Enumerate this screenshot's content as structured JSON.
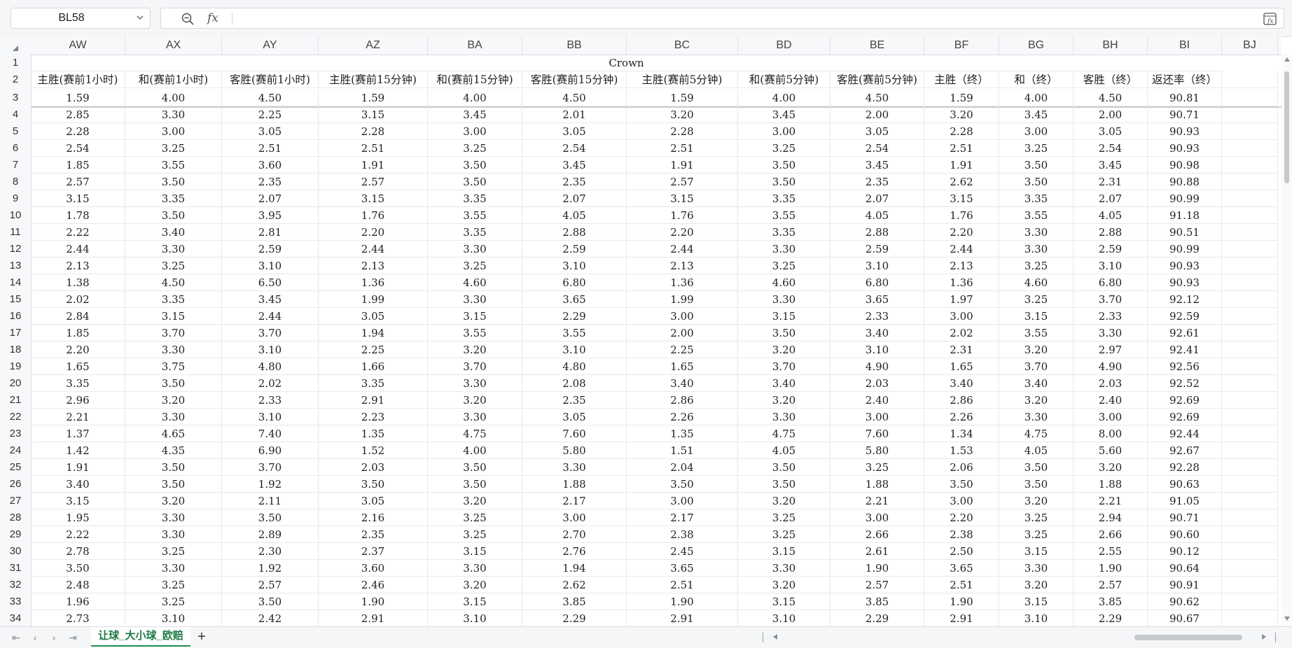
{
  "formula_bar": {
    "name_box": "BL58",
    "fx_label": "fx",
    "formula": ""
  },
  "columns": [
    "AW",
    "AX",
    "AY",
    "AZ",
    "BA",
    "BB",
    "BC",
    "BD",
    "BE",
    "BF",
    "BG",
    "BH",
    "BI",
    "BJ"
  ],
  "row_numbers": [
    1,
    2,
    3,
    4,
    5,
    6,
    7,
    8,
    9,
    10,
    11,
    12,
    13,
    14,
    15,
    16,
    17,
    18,
    19,
    20,
    21,
    22,
    23,
    24,
    25,
    26,
    27,
    28,
    29,
    30,
    31,
    32,
    33,
    34
  ],
  "title_row": "Crown",
  "header_row": [
    "主胜(赛前1小时)",
    "和(赛前1小时)",
    "客胜(赛前1小时)",
    "主胜(赛前15分钟)",
    "和(赛前15分钟)",
    "客胜(赛前15分钟)",
    "主胜(赛前5分钟)",
    "和(赛前5分钟)",
    "客胜(赛前5分钟)",
    "主胜（终）",
    "和（终）",
    "客胜（终）",
    "返还率（终）",
    ""
  ],
  "rows": [
    [
      "1.59",
      "4.00",
      "4.50",
      "1.59",
      "4.00",
      "4.50",
      "1.59",
      "4.00",
      "4.50",
      "1.59",
      "4.00",
      "4.50",
      "90.81"
    ],
    [
      "2.85",
      "3.30",
      "2.25",
      "3.15",
      "3.45",
      "2.01",
      "3.20",
      "3.45",
      "2.00",
      "3.20",
      "3.45",
      "2.00",
      "90.71"
    ],
    [
      "2.28",
      "3.00",
      "3.05",
      "2.28",
      "3.00",
      "3.05",
      "2.28",
      "3.00",
      "3.05",
      "2.28",
      "3.00",
      "3.05",
      "90.93"
    ],
    [
      "2.54",
      "3.25",
      "2.51",
      "2.51",
      "3.25",
      "2.54",
      "2.51",
      "3.25",
      "2.54",
      "2.51",
      "3.25",
      "2.54",
      "90.93"
    ],
    [
      "1.85",
      "3.55",
      "3.60",
      "1.91",
      "3.50",
      "3.45",
      "1.91",
      "3.50",
      "3.45",
      "1.91",
      "3.50",
      "3.45",
      "90.98"
    ],
    [
      "2.57",
      "3.50",
      "2.35",
      "2.57",
      "3.50",
      "2.35",
      "2.57",
      "3.50",
      "2.35",
      "2.62",
      "3.50",
      "2.31",
      "90.88"
    ],
    [
      "3.15",
      "3.35",
      "2.07",
      "3.15",
      "3.35",
      "2.07",
      "3.15",
      "3.35",
      "2.07",
      "3.15",
      "3.35",
      "2.07",
      "90.99"
    ],
    [
      "1.78",
      "3.50",
      "3.95",
      "1.76",
      "3.55",
      "4.05",
      "1.76",
      "3.55",
      "4.05",
      "1.76",
      "3.55",
      "4.05",
      "91.18"
    ],
    [
      "2.22",
      "3.40",
      "2.81",
      "2.20",
      "3.35",
      "2.88",
      "2.20",
      "3.35",
      "2.88",
      "2.20",
      "3.30",
      "2.88",
      "90.51"
    ],
    [
      "2.44",
      "3.30",
      "2.59",
      "2.44",
      "3.30",
      "2.59",
      "2.44",
      "3.30",
      "2.59",
      "2.44",
      "3.30",
      "2.59",
      "90.99"
    ],
    [
      "2.13",
      "3.25",
      "3.10",
      "2.13",
      "3.25",
      "3.10",
      "2.13",
      "3.25",
      "3.10",
      "2.13",
      "3.25",
      "3.10",
      "90.93"
    ],
    [
      "1.38",
      "4.50",
      "6.50",
      "1.36",
      "4.60",
      "6.80",
      "1.36",
      "4.60",
      "6.80",
      "1.36",
      "4.60",
      "6.80",
      "90.93"
    ],
    [
      "2.02",
      "3.35",
      "3.45",
      "1.99",
      "3.30",
      "3.65",
      "1.99",
      "3.30",
      "3.65",
      "1.97",
      "3.25",
      "3.70",
      "92.12"
    ],
    [
      "2.84",
      "3.15",
      "2.44",
      "3.05",
      "3.15",
      "2.29",
      "3.00",
      "3.15",
      "2.33",
      "3.00",
      "3.15",
      "2.33",
      "92.59"
    ],
    [
      "1.85",
      "3.70",
      "3.70",
      "1.94",
      "3.55",
      "3.55",
      "2.00",
      "3.50",
      "3.40",
      "2.02",
      "3.55",
      "3.30",
      "92.61"
    ],
    [
      "2.20",
      "3.30",
      "3.10",
      "2.25",
      "3.20",
      "3.10",
      "2.25",
      "3.20",
      "3.10",
      "2.31",
      "3.20",
      "2.97",
      "92.41"
    ],
    [
      "1.65",
      "3.75",
      "4.80",
      "1.66",
      "3.70",
      "4.80",
      "1.65",
      "3.70",
      "4.90",
      "1.65",
      "3.70",
      "4.90",
      "92.56"
    ],
    [
      "3.35",
      "3.50",
      "2.02",
      "3.35",
      "3.30",
      "2.08",
      "3.40",
      "3.40",
      "2.03",
      "3.40",
      "3.40",
      "2.03",
      "92.52"
    ],
    [
      "2.96",
      "3.20",
      "2.33",
      "2.91",
      "3.20",
      "2.35",
      "2.86",
      "3.20",
      "2.40",
      "2.86",
      "3.20",
      "2.40",
      "92.69"
    ],
    [
      "2.21",
      "3.30",
      "3.10",
      "2.23",
      "3.30",
      "3.05",
      "2.26",
      "3.30",
      "3.00",
      "2.26",
      "3.30",
      "3.00",
      "92.69"
    ],
    [
      "1.37",
      "4.65",
      "7.40",
      "1.35",
      "4.75",
      "7.60",
      "1.35",
      "4.75",
      "7.60",
      "1.34",
      "4.75",
      "8.00",
      "92.44"
    ],
    [
      "1.42",
      "4.35",
      "6.90",
      "1.52",
      "4.00",
      "5.80",
      "1.51",
      "4.05",
      "5.80",
      "1.53",
      "4.05",
      "5.60",
      "92.67"
    ],
    [
      "1.91",
      "3.50",
      "3.70",
      "2.03",
      "3.50",
      "3.30",
      "2.04",
      "3.50",
      "3.25",
      "2.06",
      "3.50",
      "3.20",
      "92.28"
    ],
    [
      "3.40",
      "3.50",
      "1.92",
      "3.50",
      "3.50",
      "1.88",
      "3.50",
      "3.50",
      "1.88",
      "3.50",
      "3.50",
      "1.88",
      "90.63"
    ],
    [
      "3.15",
      "3.20",
      "2.11",
      "3.05",
      "3.20",
      "2.17",
      "3.00",
      "3.20",
      "2.21",
      "3.00",
      "3.20",
      "2.21",
      "91.05"
    ],
    [
      "1.95",
      "3.30",
      "3.50",
      "2.16",
      "3.25",
      "3.00",
      "2.17",
      "3.25",
      "3.00",
      "2.20",
      "3.25",
      "2.94",
      "90.71"
    ],
    [
      "2.22",
      "3.30",
      "2.89",
      "2.35",
      "3.25",
      "2.70",
      "2.38",
      "3.25",
      "2.66",
      "2.38",
      "3.25",
      "2.66",
      "90.60"
    ],
    [
      "2.78",
      "3.25",
      "2.30",
      "2.37",
      "3.15",
      "2.76",
      "2.45",
      "3.15",
      "2.61",
      "2.50",
      "3.15",
      "2.55",
      "90.12"
    ],
    [
      "3.50",
      "3.30",
      "1.92",
      "3.60",
      "3.30",
      "1.94",
      "3.65",
      "3.30",
      "1.90",
      "3.65",
      "3.30",
      "1.90",
      "90.64"
    ],
    [
      "2.48",
      "3.25",
      "2.57",
      "2.46",
      "3.20",
      "2.62",
      "2.51",
      "3.20",
      "2.57",
      "2.51",
      "3.20",
      "2.57",
      "90.91"
    ],
    [
      "1.96",
      "3.25",
      "3.50",
      "1.90",
      "3.15",
      "3.85",
      "1.90",
      "3.15",
      "3.85",
      "1.90",
      "3.15",
      "3.85",
      "90.62"
    ],
    [
      "2.73",
      "3.10",
      "2.42",
      "2.91",
      "3.10",
      "2.29",
      "2.91",
      "3.10",
      "2.29",
      "2.91",
      "3.10",
      "2.29",
      "90.67"
    ]
  ],
  "sheet_tabs": [
    {
      "label": "让球_大小球_欧赔",
      "active": true
    }
  ],
  "add_sheet_label": "+",
  "nav": {
    "first": "⇤",
    "prev": "‹",
    "next": "›",
    "last": "⇥"
  },
  "colors": {
    "accent": "#1e8f4e"
  }
}
